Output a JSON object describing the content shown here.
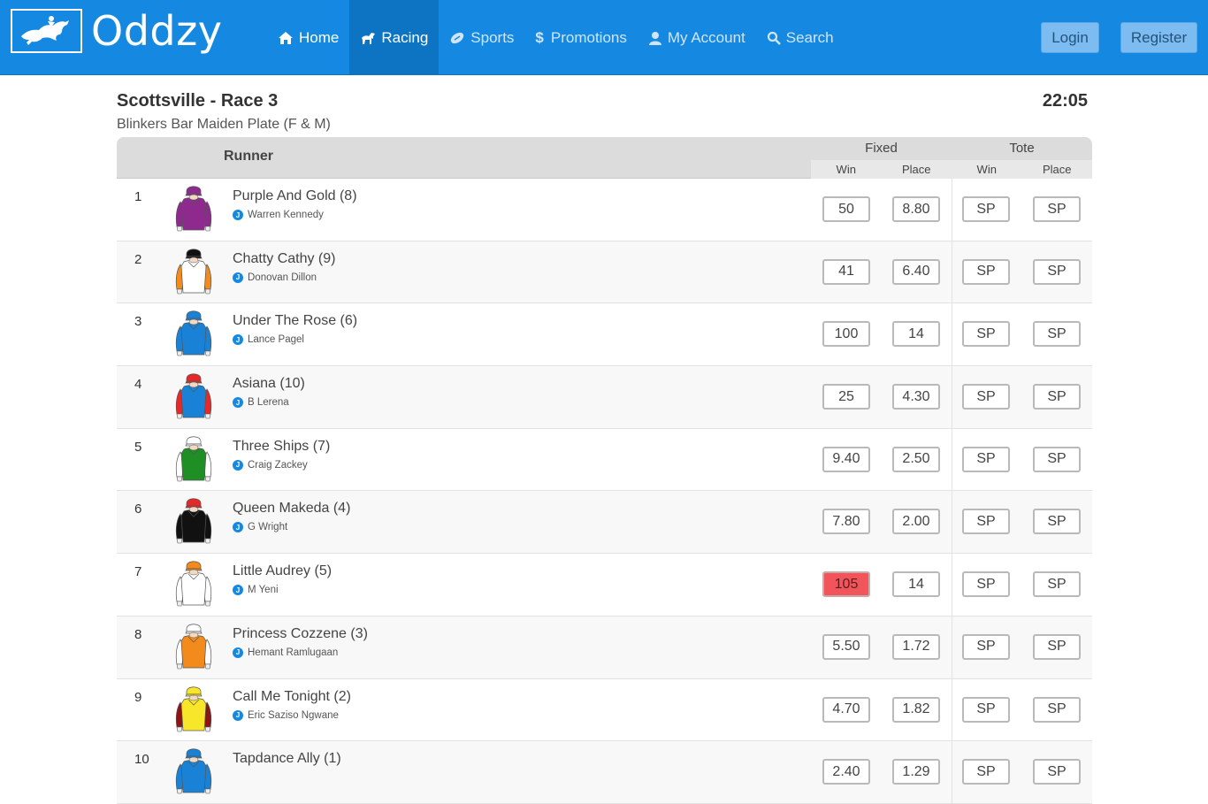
{
  "brand": {
    "name": "Oddzy"
  },
  "nav": [
    {
      "label": "Home",
      "icon": "home-icon",
      "state": "normal"
    },
    {
      "label": "Racing",
      "icon": "horse-icon",
      "state": "active"
    },
    {
      "label": "Sports",
      "icon": "football-icon",
      "state": "muted"
    },
    {
      "label": "Promotions",
      "icon": "dollar-icon",
      "state": "muted"
    },
    {
      "label": "My Account",
      "icon": "user-icon",
      "state": "muted"
    },
    {
      "label": "Search",
      "icon": "search-icon",
      "state": "muted"
    }
  ],
  "auth": {
    "login": "Login",
    "register": "Register"
  },
  "race": {
    "title": "Scottsville - Race 3",
    "subtitle": "Blinkers Bar Maiden Plate (F & M)",
    "time": "22:05"
  },
  "table": {
    "runner_header": "Runner",
    "fixed_header": "Fixed",
    "tote_header": "Tote",
    "win_header": "Win",
    "place_header": "Place"
  },
  "runners": [
    {
      "num": "1",
      "name": "Purple And Gold (8)",
      "jockey": "Warren Kennedy",
      "fixed_win": "50",
      "fixed_place": "8.80",
      "tote_win": "SP",
      "tote_place": "SP",
      "silk_body": "#8e2a8e",
      "silk_sleeve": "#8e2a8e",
      "silk_cap": "#8e2a8e"
    },
    {
      "num": "2",
      "name": "Chatty Cathy (9)",
      "jockey": "Donovan Dillon",
      "fixed_win": "41",
      "fixed_place": "6.40",
      "tote_win": "SP",
      "tote_place": "SP",
      "silk_body": "#ffffff",
      "silk_sleeve": "#f28a1c",
      "silk_cap": "#111111"
    },
    {
      "num": "3",
      "name": "Under The Rose (6)",
      "jockey": "Lance Pagel",
      "fixed_win": "100",
      "fixed_place": "14",
      "tote_win": "SP",
      "tote_place": "SP",
      "silk_body": "#1a82d6",
      "silk_sleeve": "#1a82d6",
      "silk_cap": "#1a82d6"
    },
    {
      "num": "4",
      "name": "Asiana (10)",
      "jockey": "B Lerena",
      "fixed_win": "25",
      "fixed_place": "4.30",
      "tote_win": "SP",
      "tote_place": "SP",
      "silk_body": "#1a82d6",
      "silk_sleeve": "#e62828",
      "silk_cap": "#e62828"
    },
    {
      "num": "5",
      "name": "Three Ships (7)",
      "jockey": "Craig Zackey",
      "fixed_win": "9.40",
      "fixed_place": "2.50",
      "tote_win": "SP",
      "tote_place": "SP",
      "silk_body": "#1f8f25",
      "silk_sleeve": "#ffffff",
      "silk_cap": "#ffffff"
    },
    {
      "num": "6",
      "name": "Queen Makeda (4)",
      "jockey": "G Wright",
      "fixed_win": "7.80",
      "fixed_place": "2.00",
      "tote_win": "SP",
      "tote_place": "SP",
      "silk_body": "#111111",
      "silk_sleeve": "#111111",
      "silk_cap": "#e62828"
    },
    {
      "num": "7",
      "name": "Little Audrey (5)",
      "jockey": "M Yeni",
      "fixed_win": "105",
      "fixed_place": "14",
      "tote_win": "SP",
      "tote_place": "SP",
      "silk_body": "#ffffff",
      "silk_sleeve": "#ffffff",
      "silk_cap": "#f28a1c",
      "win_highlight": true
    },
    {
      "num": "8",
      "name": "Princess Cozzene (3)",
      "jockey": "Hemant Ramlugaan",
      "fixed_win": "5.50",
      "fixed_place": "1.72",
      "tote_win": "SP",
      "tote_place": "SP",
      "silk_body": "#f28a1c",
      "silk_sleeve": "#ffffff",
      "silk_cap": "#ffffff"
    },
    {
      "num": "9",
      "name": "Call Me Tonight (2)",
      "jockey": "Eric Saziso Ngwane",
      "fixed_win": "4.70",
      "fixed_place": "1.82",
      "tote_win": "SP",
      "tote_place": "SP",
      "silk_body": "#f7e62a",
      "silk_sleeve": "#8b1414",
      "silk_cap": "#f7e62a"
    },
    {
      "num": "10",
      "name": "Tapdance Ally (1)",
      "jockey": "",
      "fixed_win": "2.40",
      "fixed_place": "1.29",
      "tote_win": "SP",
      "tote_place": "SP",
      "silk_body": "#1a82d6",
      "silk_sleeve": "#1a82d6",
      "silk_cap": "#1a82d6"
    }
  ],
  "colors": {
    "header_blue": "#1589e2",
    "active_nav": "#0d74c4",
    "highlight_red": "#f2545b"
  }
}
